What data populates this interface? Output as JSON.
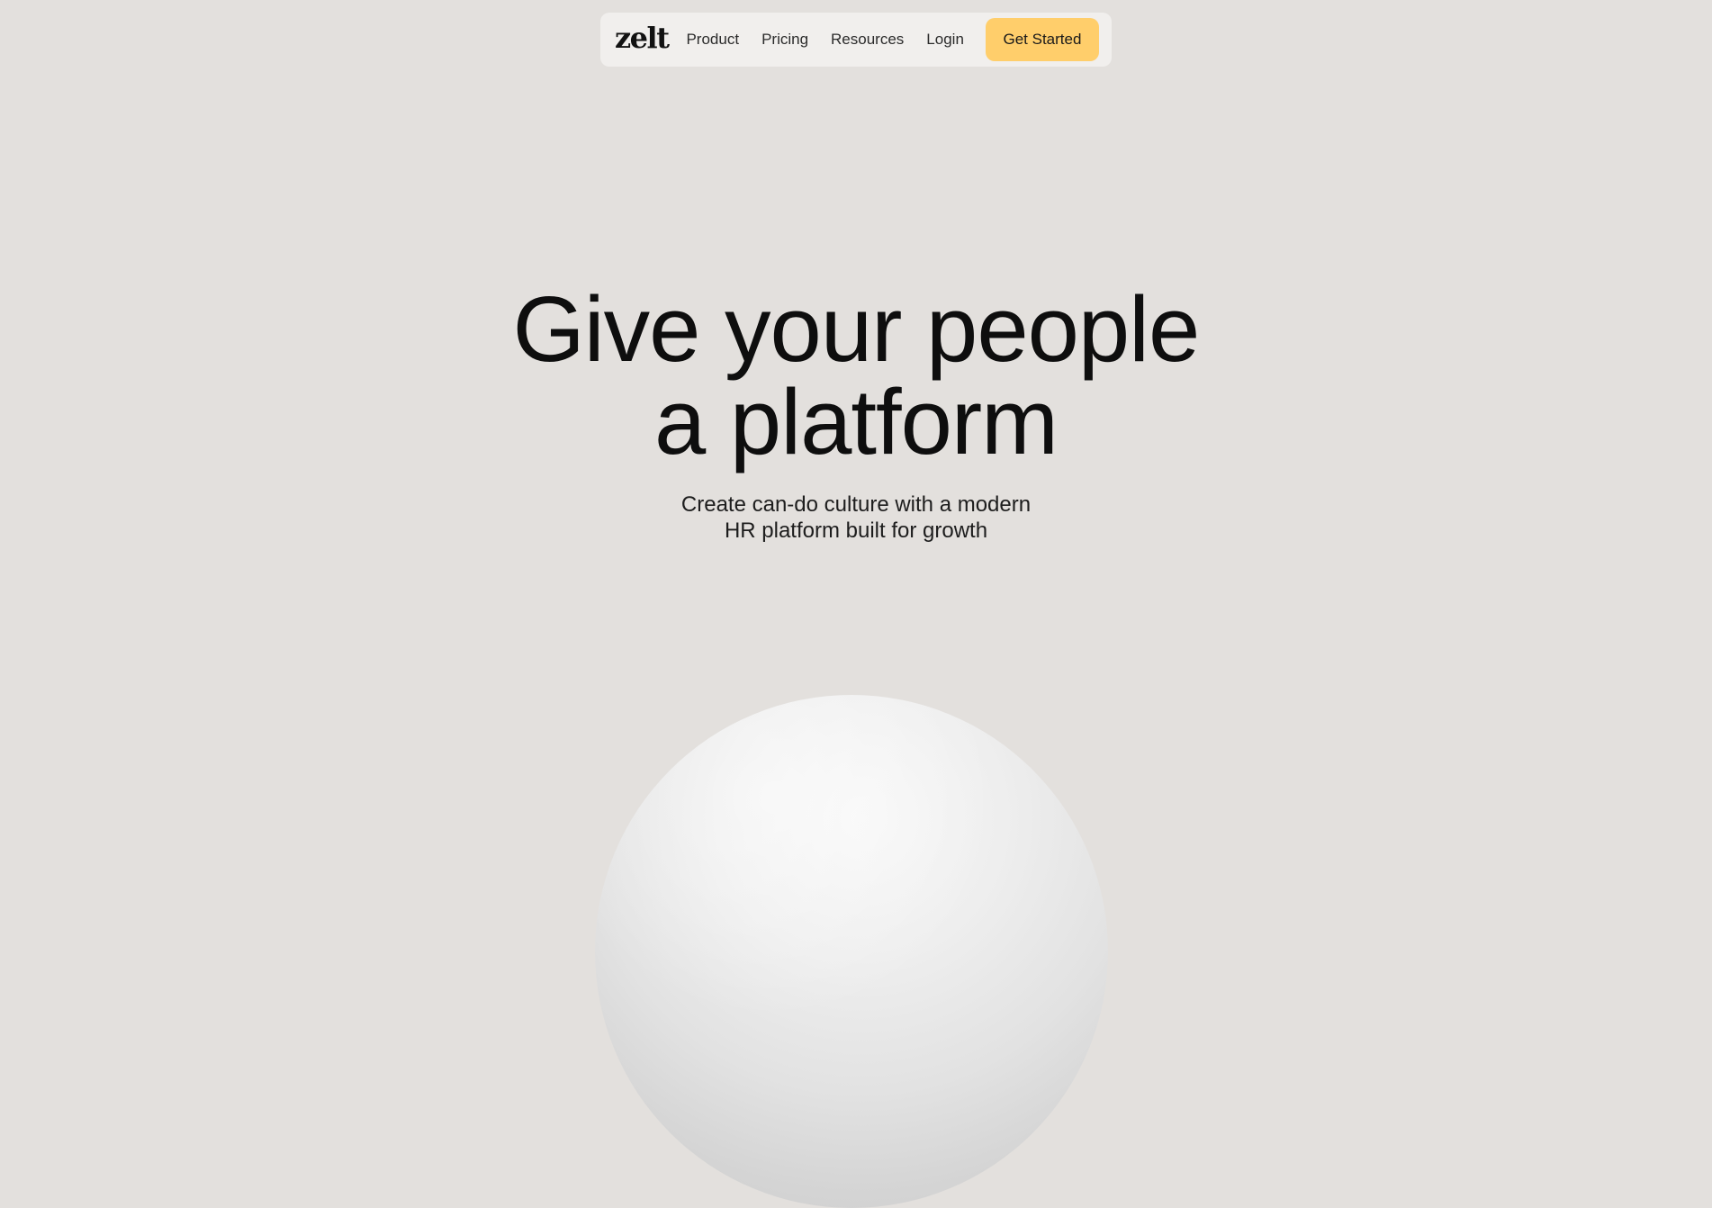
{
  "brand": {
    "logo_text": "zelt"
  },
  "nav": {
    "links": [
      "Product",
      "Pricing",
      "Resources",
      "Login"
    ],
    "cta_label": "Get Started"
  },
  "hero": {
    "headline_line1": "Give your people",
    "headline_line2": "a platform",
    "subtitle_line1": "Create can-do culture with a modern",
    "subtitle_line2": "HR platform built for growth"
  },
  "colors": {
    "background": "#e3e0dd",
    "nav_background": "#f1efed",
    "cta_background": "#ffce6b",
    "text": "#0e0e0e"
  },
  "decoration": {
    "orb": "white-sphere-image"
  }
}
